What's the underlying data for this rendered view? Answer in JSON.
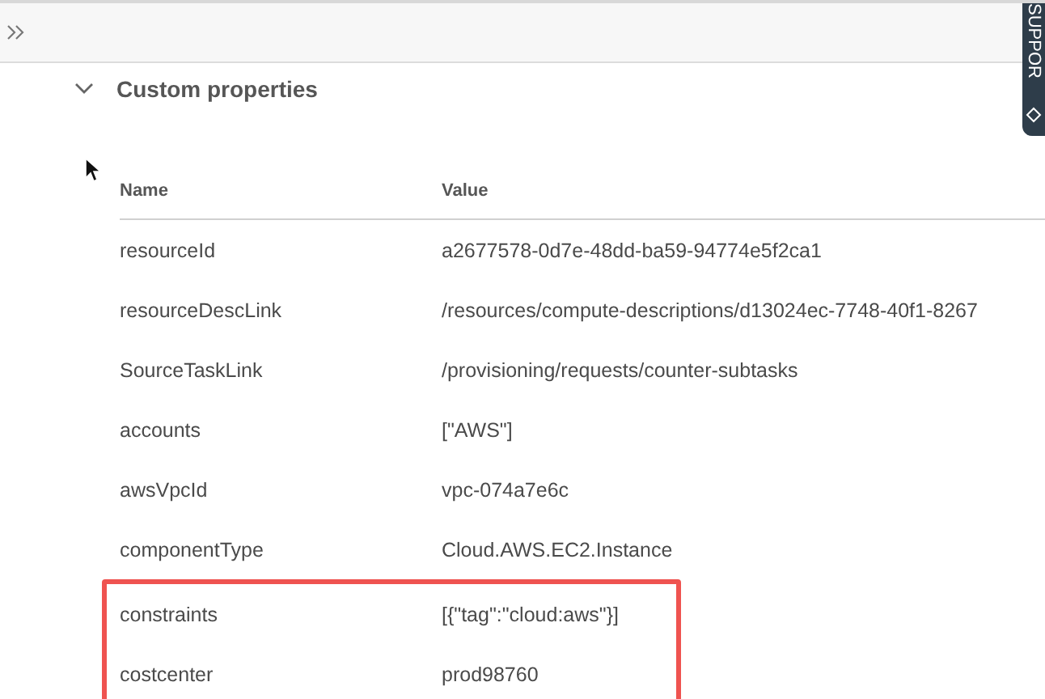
{
  "section": {
    "title": "Custom properties",
    "expanded": true
  },
  "support_tab": {
    "label": "SUPPOR"
  },
  "table": {
    "columns": [
      "Name",
      "Value"
    ],
    "rows": [
      {
        "name": "resourceId",
        "value": "a2677578-0d7e-48dd-ba59-94774e5f2ca1",
        "highlighted": false
      },
      {
        "name": "resourceDescLink",
        "value": "/resources/compute-descriptions/d13024ec-7748-40f1-8267",
        "highlighted": false
      },
      {
        "name": "SourceTaskLink",
        "value": "/provisioning/requests/counter-subtasks",
        "highlighted": false
      },
      {
        "name": "accounts",
        "value": "[\"AWS\"]",
        "highlighted": false
      },
      {
        "name": "awsVpcId",
        "value": "vpc-074a7e6c",
        "highlighted": false
      },
      {
        "name": "componentType",
        "value": "Cloud.AWS.EC2.Instance",
        "highlighted": false
      },
      {
        "name": "constraints",
        "value": "[{\"tag\":\"cloud:aws\"}]",
        "highlighted": true
      },
      {
        "name": "costcenter",
        "value": "prod98760",
        "highlighted": true
      }
    ]
  }
}
